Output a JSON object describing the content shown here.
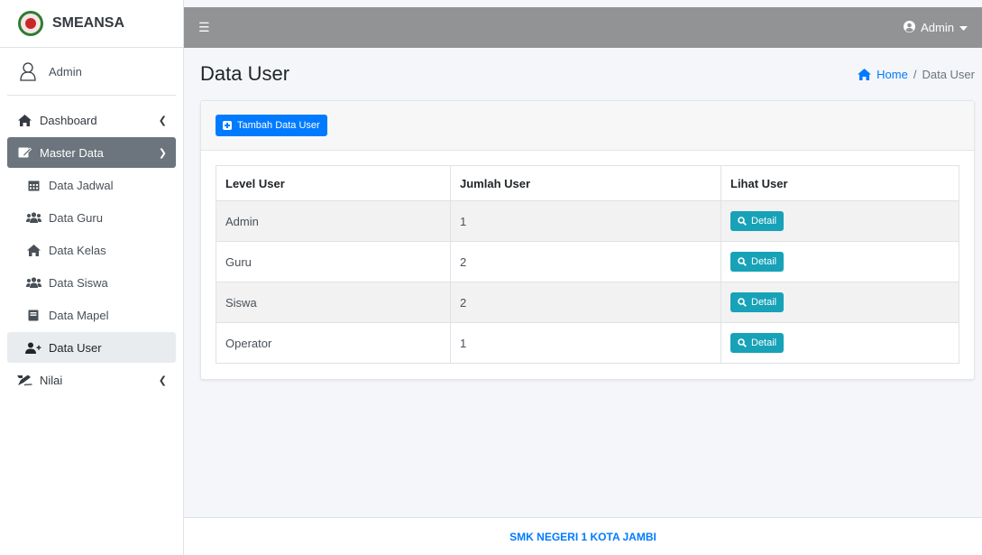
{
  "brand": {
    "name": "SMEANSA"
  },
  "user_panel": {
    "name": "Admin"
  },
  "sidebar": {
    "items": [
      {
        "label": "Dashboard",
        "icon": "home-icon"
      },
      {
        "label": "Master Data",
        "icon": "edit-icon"
      },
      {
        "label": "Data Jadwal",
        "icon": "calendar-icon"
      },
      {
        "label": "Data Guru",
        "icon": "users-icon"
      },
      {
        "label": "Data Kelas",
        "icon": "home-icon"
      },
      {
        "label": "Data Siswa",
        "icon": "users-icon"
      },
      {
        "label": "Data Mapel",
        "icon": "book-icon"
      },
      {
        "label": "Data User",
        "icon": "user-plus-icon"
      },
      {
        "label": "Nilai",
        "icon": "signature-icon"
      }
    ]
  },
  "topbar": {
    "user_label": "Admin"
  },
  "header": {
    "title": "Data User"
  },
  "breadcrumb": {
    "home": "Home",
    "separator": "/",
    "current": "Data User"
  },
  "card": {
    "add_button_label": "Tambah Data User"
  },
  "table": {
    "headers": [
      "Level User",
      "Jumlah User",
      "Lihat User"
    ],
    "rows": [
      {
        "level": "Admin",
        "count": "1",
        "action": "Detail"
      },
      {
        "level": "Guru",
        "count": "2",
        "action": "Detail"
      },
      {
        "level": "Siswa",
        "count": "2",
        "action": "Detail"
      },
      {
        "level": "Operator",
        "count": "1",
        "action": "Detail"
      }
    ]
  },
  "footer": {
    "text": "SMK NEGERI 1 KOTA JAMBI"
  },
  "colors": {
    "primary": "#007bff",
    "info": "#17a2b8",
    "topbar": "#919395",
    "active_menu": "#6c757d"
  }
}
